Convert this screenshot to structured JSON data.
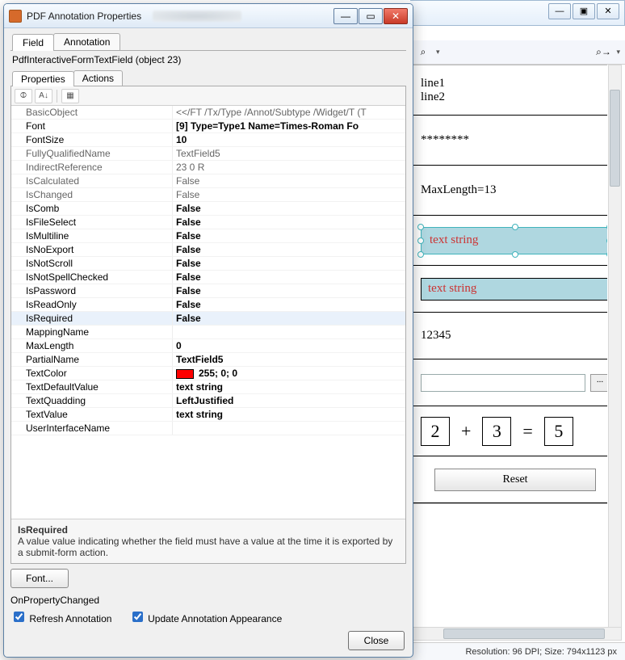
{
  "dialog": {
    "title": "PDF Annotation Properties",
    "window_controls": {
      "min": "—",
      "max": "▭",
      "close": "✕"
    },
    "tabs": {
      "field": "Field",
      "annotation": "Annotation",
      "active": "field"
    },
    "object_line": "PdfInteractiveFormTextField (object 23)",
    "subtabs": {
      "properties": "Properties",
      "actions": "Actions",
      "active": "properties"
    },
    "propgrid_toolbar": {
      "categorized": "⦷",
      "alphabetical": "A↓",
      "property_pages": "▦"
    },
    "properties": [
      {
        "key": "BasicObject",
        "value": "<</FT /Tx/Type /Annot/Subtype /Widget/T (T",
        "bold": false
      },
      {
        "key": "Font",
        "value": "[9] Type=Type1 Name=Times-Roman Fo",
        "bold": true
      },
      {
        "key": "FontSize",
        "value": "10",
        "bold": true
      },
      {
        "key": "FullyQualifiedName",
        "value": "TextField5",
        "bold": false
      },
      {
        "key": "IndirectReference",
        "value": "23 0 R",
        "bold": false
      },
      {
        "key": "IsCalculated",
        "value": "False",
        "bold": false
      },
      {
        "key": "IsChanged",
        "value": "False",
        "bold": false
      },
      {
        "key": "IsComb",
        "value": "False",
        "bold": true
      },
      {
        "key": "IsFileSelect",
        "value": "False",
        "bold": true
      },
      {
        "key": "IsMultiline",
        "value": "False",
        "bold": true
      },
      {
        "key": "IsNoExport",
        "value": "False",
        "bold": true
      },
      {
        "key": "IsNotScroll",
        "value": "False",
        "bold": true
      },
      {
        "key": "IsNotSpellChecked",
        "value": "False",
        "bold": true
      },
      {
        "key": "IsPassword",
        "value": "False",
        "bold": true
      },
      {
        "key": "IsReadOnly",
        "value": "False",
        "bold": true
      },
      {
        "key": "IsRequired",
        "value": "False",
        "bold": true,
        "highlighted": true
      },
      {
        "key": "MappingName",
        "value": "",
        "bold": true
      },
      {
        "key": "MaxLength",
        "value": "0",
        "bold": true
      },
      {
        "key": "PartialName",
        "value": "TextField5",
        "bold": true
      },
      {
        "key": "TextColor",
        "value": "255; 0; 0",
        "bold": true,
        "swatch": "#ff0000"
      },
      {
        "key": "TextDefaultValue",
        "value": "text string",
        "bold": true
      },
      {
        "key": "TextQuadding",
        "value": "LeftJustified",
        "bold": true
      },
      {
        "key": "TextValue",
        "value": "text string",
        "bold": true
      },
      {
        "key": "UserInterfaceName",
        "value": "",
        "bold": true
      }
    ],
    "help": {
      "name": "IsRequired",
      "desc": "A value value indicating whether the field must have a value at the time it is exported by a submit-form action."
    },
    "font_button": "Font...",
    "events_label": "OnPropertyChanged",
    "checkboxes": {
      "refresh": "Refresh Annotation",
      "update": "Update Annotation Appearance"
    },
    "close_button": "Close"
  },
  "background": {
    "window_controls": {
      "min": "—",
      "max": "▣",
      "close": "✕"
    },
    "toolbar": {
      "find": "⌕",
      "find_next": "⌕→"
    },
    "pdf_rows": {
      "line1": "line1",
      "line2": "line2",
      "password": "********",
      "maxlength": "MaxLength=13",
      "selected_text": "text string",
      "plain_text": "text string",
      "numeric": "12345",
      "browse_btn": "...",
      "calc_a": "2",
      "calc_op": "+",
      "calc_b": "3",
      "calc_eq": "=",
      "calc_r": "5",
      "reset": "Reset"
    },
    "status": "Resolution: 96 DPI; Size: 794x1123 px"
  }
}
